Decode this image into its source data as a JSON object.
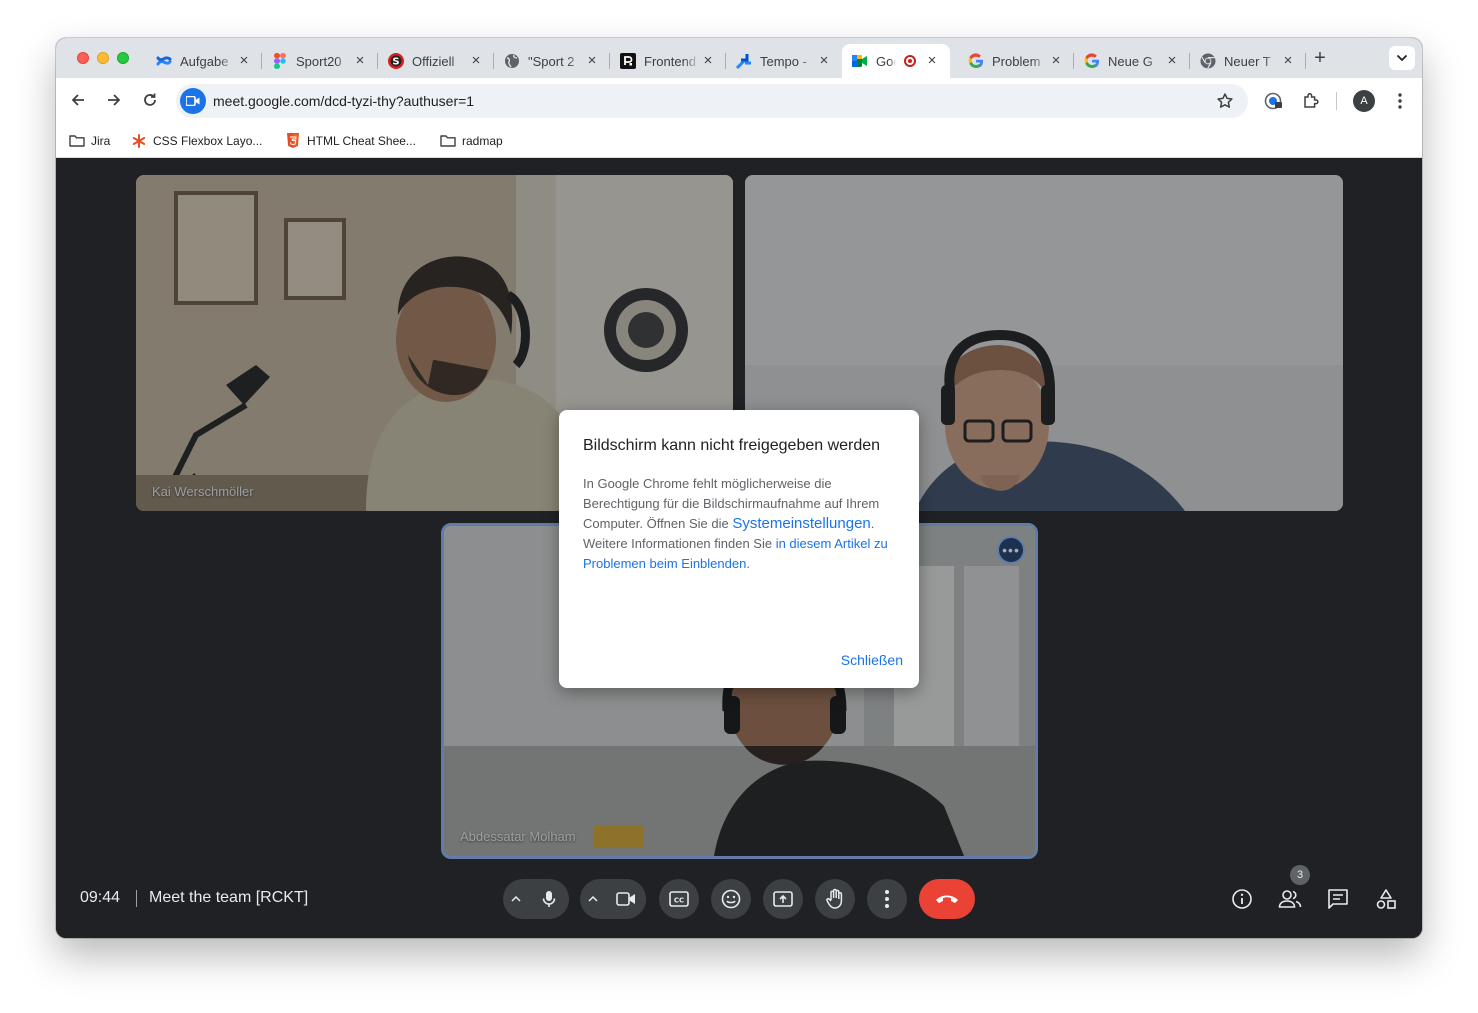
{
  "browser": {
    "tabs": [
      {
        "title": "Aufgabe",
        "icon": "confluence-icon"
      },
      {
        "title": "Sport20",
        "icon": "figma-icon"
      },
      {
        "title": "Offiziell",
        "icon": "s-logo-icon"
      },
      {
        "title": "\"Sport 2",
        "icon": "globe-icon"
      },
      {
        "title": "Frontend",
        "icon": "r-logo-icon"
      },
      {
        "title": "Tempo -",
        "icon": "tempo-icon"
      },
      {
        "title": "Goo",
        "icon": "google-meet-icon",
        "active": true,
        "recording": true
      },
      {
        "title": "Problem",
        "icon": "google-icon"
      },
      {
        "title": "Neue G",
        "icon": "google-icon"
      },
      {
        "title": "Neuer T",
        "icon": "chrome-icon"
      }
    ],
    "url": "meet.google.com/dcd-tyzi-thy?authuser=1",
    "profile_initial": "A",
    "bookmarks": [
      {
        "label": "Jira",
        "icon": "folder-icon"
      },
      {
        "label": "CSS Flexbox Layo...",
        "icon": "asterisk-icon"
      },
      {
        "label": "HTML Cheat Shee...",
        "icon": "html5-icon"
      },
      {
        "label": "radmap",
        "icon": "folder-icon"
      }
    ]
  },
  "meet": {
    "participants": [
      {
        "name": "Kai Werschmöller"
      },
      {
        "name": ""
      },
      {
        "name": "Abdessatar Molham"
      }
    ],
    "dialog": {
      "title": "Bildschirm kann nicht freigegeben werden",
      "body_1": "In Google Chrome fehlt möglicherweise die Berechtigung für die Bildschirmaufnahme auf Ihrem Computer. Öffnen Sie die ",
      "link_settings": "Systemeinstellungen",
      "body_2": ". Weitere Informationen finden Sie ",
      "link_article": "in diesem Artikel zu Problemen beim Einblenden",
      "body_3": ".",
      "close_label": "Schließen"
    },
    "bottom_bar": {
      "time": "09:44",
      "meeting_title": "Meet the team [RCKT]",
      "participant_count": "3"
    },
    "colors": {
      "accent": "#1a73e8",
      "hangup": "#ea4335",
      "control_bg": "#3c4043",
      "stage_bg": "#202124"
    }
  }
}
